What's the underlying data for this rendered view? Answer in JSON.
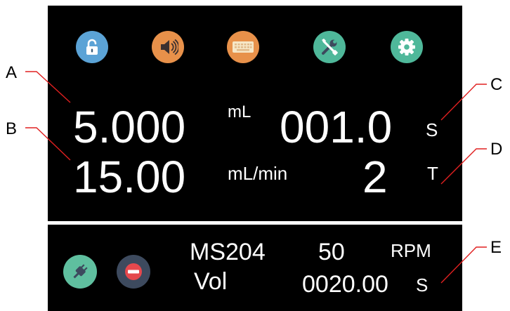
{
  "colors": {
    "background": "#000000",
    "text": "#ffffff",
    "callout_line": "#e02020",
    "lock_icon": "#5ba3d6",
    "sound_icon": "#e8914a",
    "keyboard_icon": "#e8914a",
    "tools_icon": "#4fb89a",
    "settings_icon": "#4fb89a",
    "plug_icon": "#5fbf9f",
    "stop_icon": "#3d4a5e"
  },
  "toolbar": {
    "icons": [
      "unlock-icon",
      "sound-icon",
      "keyboard-icon",
      "tools-icon",
      "settings-icon"
    ]
  },
  "main": {
    "volume_value": "5.000",
    "volume_unit": "mL",
    "time_value": "001.0",
    "time_unit": "S",
    "flow_value": "15.00",
    "flow_unit": "mL/min",
    "count_value": "2",
    "count_unit": "T"
  },
  "status": {
    "icons": [
      "plug-icon",
      "stop-icon"
    ],
    "model": "MS204",
    "mode": "Vol",
    "speed_value": "50",
    "speed_unit": "RPM",
    "run_time_value": "0020.00",
    "run_time_unit": "S"
  },
  "callouts": {
    "a": "A",
    "b": "B",
    "c": "C",
    "d": "D",
    "e": "E"
  }
}
